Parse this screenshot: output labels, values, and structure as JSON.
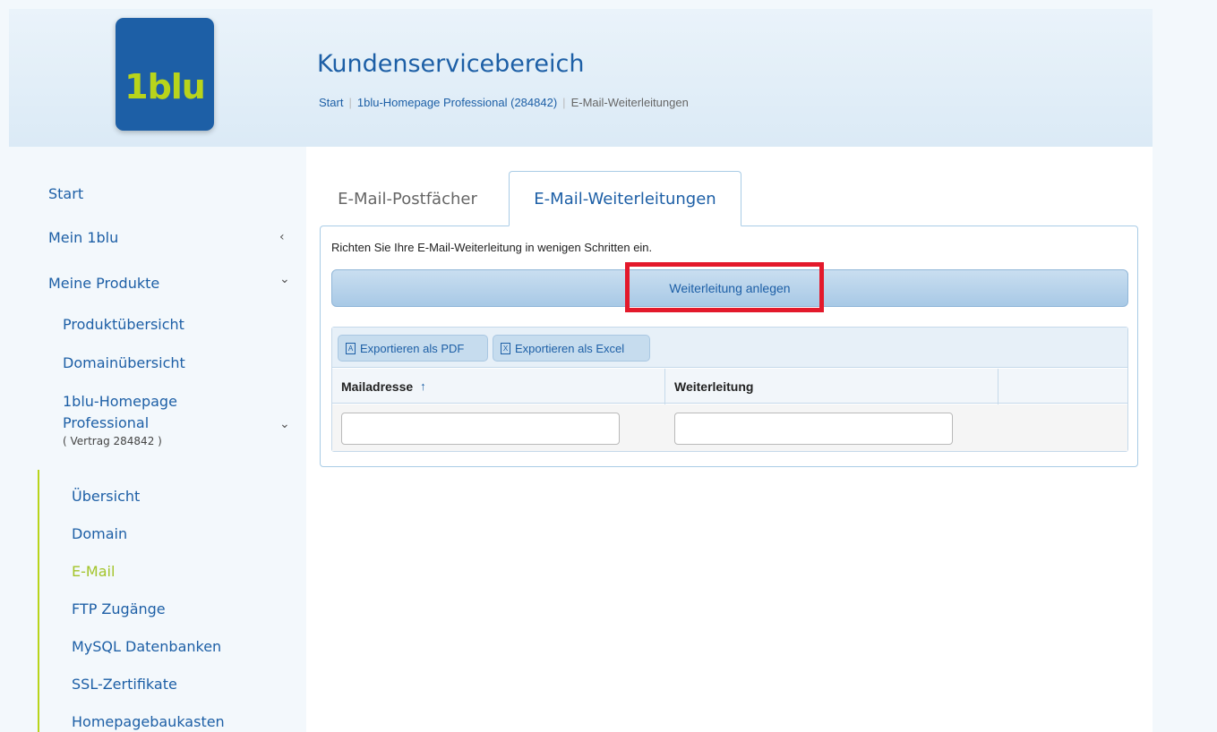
{
  "header": {
    "logo_text": "1blu",
    "title": "Kundenservicebereich",
    "breadcrumb": [
      "Start",
      "1blu-Homepage Professional (284842)",
      "E-Mail-Weiterleitungen"
    ]
  },
  "sidebar": {
    "items": [
      {
        "label": "Start"
      },
      {
        "label": "Mein 1blu",
        "arrow": "‹"
      },
      {
        "label": "Meine Produkte",
        "arrow": "⌄"
      },
      {
        "label": "Produktübersicht"
      },
      {
        "label": "Domainübersicht"
      },
      {
        "label": "1blu-Homepage",
        "label2": "Professional",
        "note": "( Vertrag 284842 )",
        "arrow": "⌄"
      },
      {
        "label": "Übersicht"
      },
      {
        "label": "Domain"
      },
      {
        "label": "E-Mail"
      },
      {
        "label": "FTP Zugänge"
      },
      {
        "label": "MySQL Datenbanken"
      },
      {
        "label": "SSL-Zertifikate"
      },
      {
        "label": "Homepagebaukasten"
      }
    ]
  },
  "main": {
    "tabs": [
      {
        "label": "E-Mail-Postfächer"
      },
      {
        "label": "E-Mail-Weiterleitungen"
      }
    ],
    "intro": "Richten Sie Ihre E-Mail-Weiterleitung in wenigen Schritten ein.",
    "create_button": "Weiterleitung anlegen",
    "export_pdf": "Exportieren als PDF",
    "export_excel": "Exportieren als Excel",
    "columns": [
      "Mailadresse",
      "Weiterleitung",
      ""
    ],
    "sort_arrow": "↑",
    "filter_mail_value": "",
    "filter_forward_value": ""
  },
  "colors": {
    "brand_blue": "#1d5fa6",
    "brand_green": "#b8d41b",
    "highlight_red": "#e3192b"
  }
}
